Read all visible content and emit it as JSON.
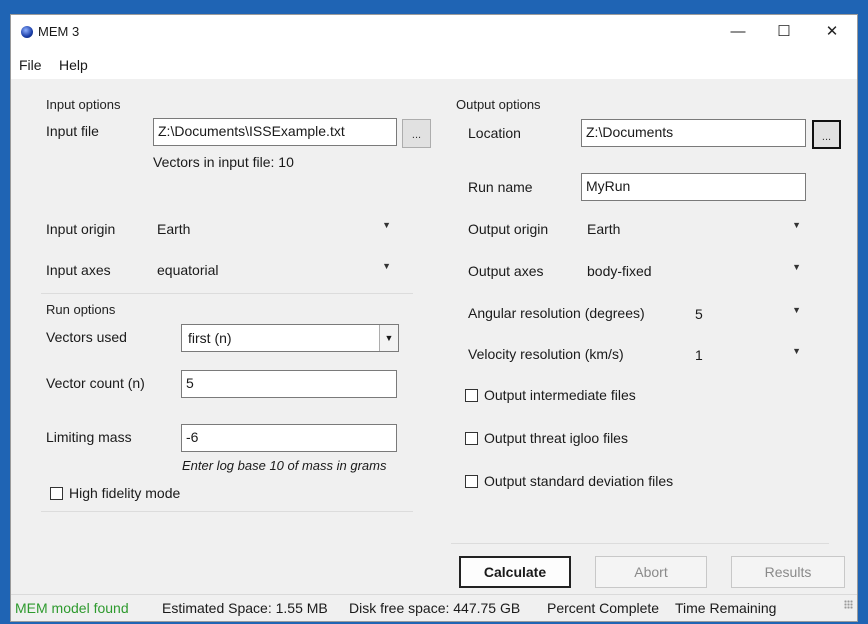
{
  "window": {
    "title": "MEM 3",
    "minimize": "—",
    "maximize": "☐",
    "close": "✕"
  },
  "menu": {
    "file": "File",
    "help": "Help"
  },
  "input_options": {
    "section_title": "Input options",
    "input_file_label": "Input file",
    "input_file_value": "Z:\\Documents\\ISSExample.txt",
    "browse_label": "...",
    "vectors_info": "Vectors in input file: 10",
    "origin_label": "Input origin",
    "origin_value": "Earth",
    "axes_label": "Input axes",
    "axes_value": "equatorial"
  },
  "run_options": {
    "section_title": "Run options",
    "vectors_used_label": "Vectors used",
    "vectors_used_value": "first (n)",
    "vector_count_label": "Vector count (n)",
    "vector_count_value": "5",
    "limiting_mass_label": "Limiting mass",
    "limiting_mass_value": "-6",
    "limiting_mass_hint": "Enter log base 10 of mass in grams",
    "high_fidelity_label": "High fidelity mode",
    "high_fidelity_checked": false
  },
  "output_options": {
    "section_title": "Output options",
    "location_label": "Location",
    "location_value": "Z:\\Documents",
    "browse_label": "...",
    "run_name_label": "Run name",
    "run_name_value": "MyRun",
    "origin_label": "Output origin",
    "origin_value": "Earth",
    "axes_label": "Output axes",
    "axes_value": "body-fixed",
    "angular_label": "Angular resolution (degrees)",
    "angular_value": "5",
    "velocity_label": "Velocity resolution (km/s)",
    "velocity_value": "1",
    "intermediate_label": "Output intermediate files",
    "igloo_label": "Output threat igloo files",
    "stddev_label": "Output standard deviation files"
  },
  "buttons": {
    "calculate": "Calculate",
    "abort": "Abort",
    "results": "Results"
  },
  "status": {
    "model": "MEM model found",
    "space": "Estimated Space: 1.55 MB",
    "free": "Disk free space: 447.75 GB",
    "percent": "Percent Complete",
    "time": "Time Remaining"
  },
  "icons": {
    "app": "globe-icon",
    "dropdown": "chevron-down-icon",
    "resize": "resize-grip-icon"
  },
  "colors": {
    "desktop": "#1f64b4",
    "status_ok": "#2e9a2e"
  }
}
